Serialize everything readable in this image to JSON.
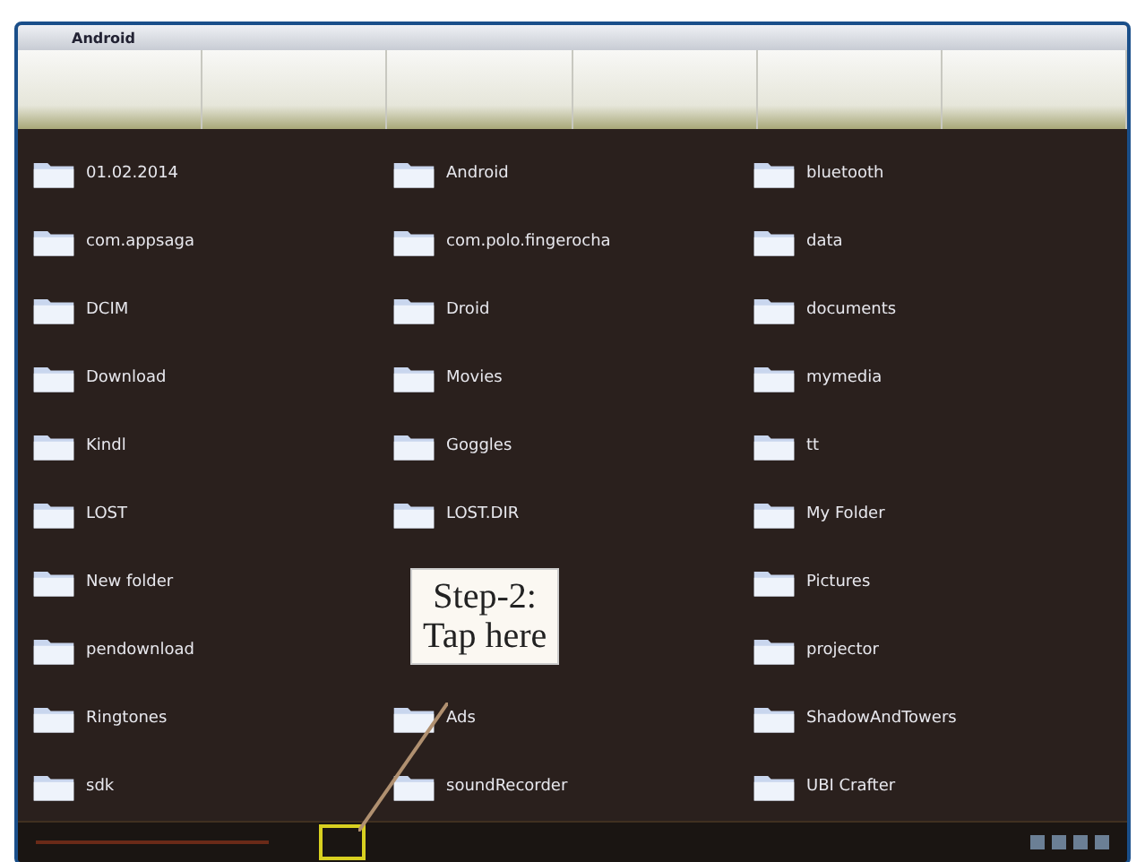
{
  "window": {
    "title": "Android"
  },
  "columns": [
    [
      {
        "kind": "folder",
        "name": "01.02.2014"
      },
      {
        "kind": "folder",
        "name": "com.appsaga"
      },
      {
        "kind": "folder",
        "name": "DCIM"
      },
      {
        "kind": "folder",
        "name": "Download"
      },
      {
        "kind": "folder",
        "name": "Kindl"
      },
      {
        "kind": "folder",
        "name": "LOST"
      },
      {
        "kind": "folder",
        "name": "New folder"
      },
      {
        "kind": "folder",
        "name": "pendownload"
      },
      {
        "kind": "folder",
        "name": "Ringtones"
      },
      {
        "kind": "folder",
        "name": "sdk"
      }
    ],
    [
      {
        "kind": "folder",
        "name": "Android"
      },
      {
        "kind": "folder",
        "name": "com.polo.fingerocha"
      },
      {
        "kind": "folder",
        "name": "Droid"
      },
      {
        "kind": "folder",
        "name": "Movies"
      },
      {
        "kind": "folder",
        "name": "Goggles"
      },
      {
        "kind": "folder",
        "name": "LOST.DIR"
      },
      {
        "kind": "callout",
        "lines": [
          "Step-2:",
          "Tap here"
        ]
      },
      {
        "kind": "folder",
        "name": "Ads"
      },
      {
        "kind": "folder",
        "name": "soundRecorder"
      }
    ],
    [
      {
        "kind": "folder",
        "name": "bluetooth"
      },
      {
        "kind": "folder",
        "name": "data"
      },
      {
        "kind": "folder",
        "name": "documents"
      },
      {
        "kind": "folder",
        "name": "mymedia"
      },
      {
        "kind": "folder",
        "name": "tt"
      },
      {
        "kind": "folder",
        "name": "My Folder"
      },
      {
        "kind": "folder",
        "name": "Pictures"
      },
      {
        "kind": "folder",
        "name": "projector"
      },
      {
        "kind": "folder",
        "name": "ShadowAndTowers"
      },
      {
        "kind": "folder",
        "name": "UBI Crafter"
      }
    ]
  ]
}
